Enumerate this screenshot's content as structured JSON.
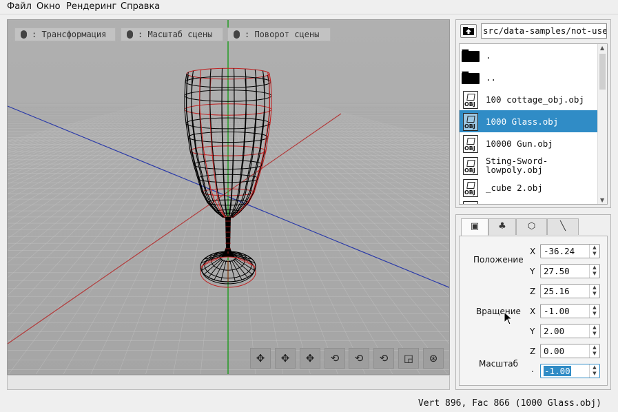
{
  "menu": {
    "file": "Файл",
    "window": "Окно",
    "render": "Рендеринг",
    "help": "Справка"
  },
  "viewport": {
    "hints": {
      "transform": ": Трансформация",
      "scale": ": Масштаб сцены",
      "rotate": ": Поворот сцены"
    },
    "toolbar_icons": [
      "move-icon",
      "move-icon",
      "move-icon",
      "rotate-icon",
      "rotate-icon",
      "rotate-icon",
      "scale-icon",
      "reset-icon"
    ]
  },
  "file_browser": {
    "path": "src/data-samples/not-used",
    "items": [
      {
        "label": ".",
        "type": "folder"
      },
      {
        "label": "..",
        "type": "folder"
      },
      {
        "label": "100 cottage_obj.obj",
        "type": "obj"
      },
      {
        "label": "1000 Glass.obj",
        "type": "obj",
        "selected": true
      },
      {
        "label": "10000 Gun.obj",
        "type": "obj"
      },
      {
        "label": "Sting-Sword-\nlowpoly.obj",
        "type": "obj"
      },
      {
        "label": "_cube 2.obj",
        "type": "obj"
      },
      {
        "label": "",
        "type": "obj"
      }
    ],
    "icon_tag": "OBJ"
  },
  "properties": {
    "tabs": [
      "transform-tab-icon",
      "tree-tab-icon",
      "mesh-tab-icon",
      "line-tab-icon"
    ],
    "position_label": "Положение",
    "rotation_label": "Вращение",
    "scale_label": "Масштаб",
    "axes": {
      "x": "X",
      "y": "Y",
      "z": "Z",
      "dot": "."
    },
    "position": {
      "x": "-36.24",
      "y": "27.50",
      "z": "25.16"
    },
    "rotation": {
      "x": "-1.00",
      "y": "2.00",
      "z": "0.00"
    },
    "scale": "-1.00"
  },
  "status": "Vert 896, Fac 866 (1000 Glass.obj)",
  "colors": {
    "selection": "#308cc6",
    "axis_x": "#b33a3a",
    "axis_z": "#2a3aa8",
    "axis_y": "#1a9a1a",
    "wire": "#000000",
    "wire_highlight": "#cc2222"
  }
}
